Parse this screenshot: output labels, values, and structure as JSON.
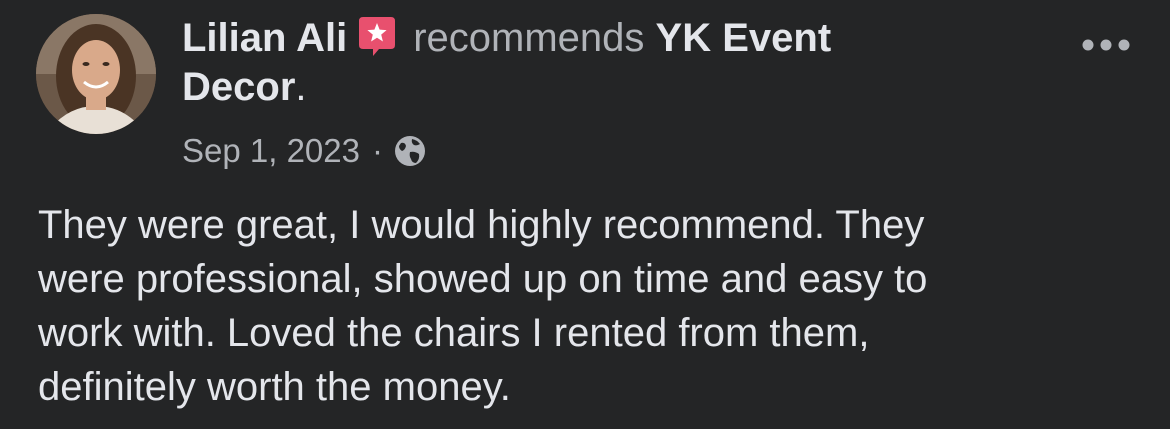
{
  "post": {
    "author": "Lilian Ali",
    "verb": "recommends",
    "page_name_line1": "YK Event",
    "page_name_line2": "Decor",
    "period": ".",
    "date": "Sep 1, 2023",
    "separator": "·",
    "audience_icon": "globe-icon",
    "recommend_icon": "recommendation-star-icon",
    "more_icon": "more-options-icon",
    "review_lines": [
      "They were great, I would highly recommend. They",
      "were professional, showed up on time and easy to",
      "work with. Loved the chairs I rented from them,",
      "definitely worth the money."
    ]
  },
  "colors": {
    "background": "#242526",
    "primary_text": "#e4e6eb",
    "secondary_text": "#b0b3b8",
    "recommend_badge": "#e8506e"
  }
}
